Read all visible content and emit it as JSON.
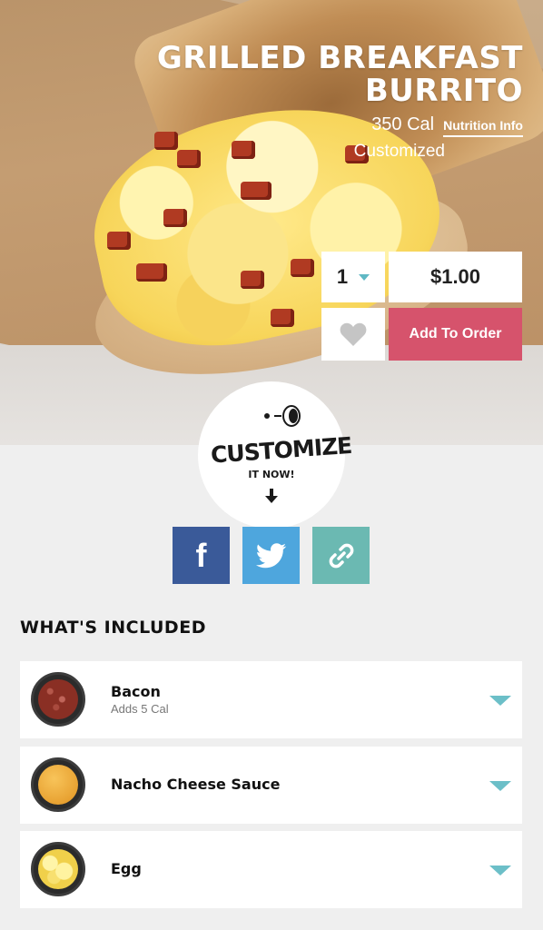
{
  "product": {
    "title": "GRILLED BREAKFAST BURRITO",
    "calories": "350 Cal",
    "nutrition_link": "Nutrition Info",
    "status": "Customized"
  },
  "order": {
    "quantity": "1",
    "price": "$1.00",
    "add_label": "Add To Order"
  },
  "customize": {
    "word": "CUSTOMIZE",
    "sub": "IT NOW!"
  },
  "share": {
    "facebook": "f"
  },
  "included": {
    "heading": "WHAT'S INCLUDED",
    "items": [
      {
        "name": "Bacon",
        "note": "Adds 5 Cal",
        "icon": "bacon-thumbnail"
      },
      {
        "name": "Nacho Cheese Sauce",
        "note": "",
        "icon": "cheese-sauce-thumbnail"
      },
      {
        "name": "Egg",
        "note": "",
        "icon": "egg-thumbnail"
      }
    ]
  },
  "colors": {
    "accent_red": "#d6536c",
    "teal": "#6cbfc8",
    "facebook": "#3a5a99",
    "twitter": "#4ea6dd",
    "link": "#6bb9b2"
  }
}
